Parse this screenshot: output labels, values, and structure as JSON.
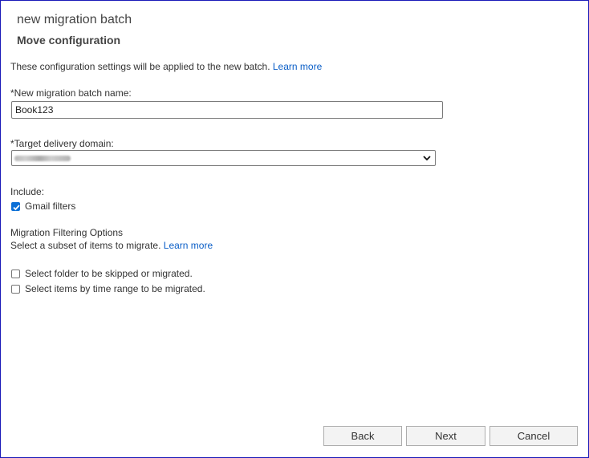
{
  "header": {
    "title": "new migration batch",
    "subtitle": "Move configuration"
  },
  "intro": {
    "text": "These configuration settings will be applied to the new batch.",
    "link": "Learn more"
  },
  "batch_name": {
    "label": "*New migration batch name:",
    "value": "Book123"
  },
  "delivery_domain": {
    "label": "*Target delivery domain:",
    "chevron_icon": "chevron-down-icon"
  },
  "include": {
    "label": "Include:",
    "gmail_filters": {
      "label": "Gmail filters",
      "checked": true
    }
  },
  "filtering": {
    "heading": "Migration Filtering Options",
    "description": "Select a subset of items to migrate.",
    "link": "Learn more",
    "options": [
      {
        "label": "Select folder to be skipped or migrated.",
        "checked": false
      },
      {
        "label": "Select items by time range to be migrated.",
        "checked": false
      }
    ]
  },
  "footer": {
    "back_label": "Back",
    "next_label": "Next",
    "cancel_label": "Cancel"
  },
  "colors": {
    "accent": "#0b6fd6",
    "link": "#0a5ec7",
    "frame_border": "#1a1ab8"
  }
}
